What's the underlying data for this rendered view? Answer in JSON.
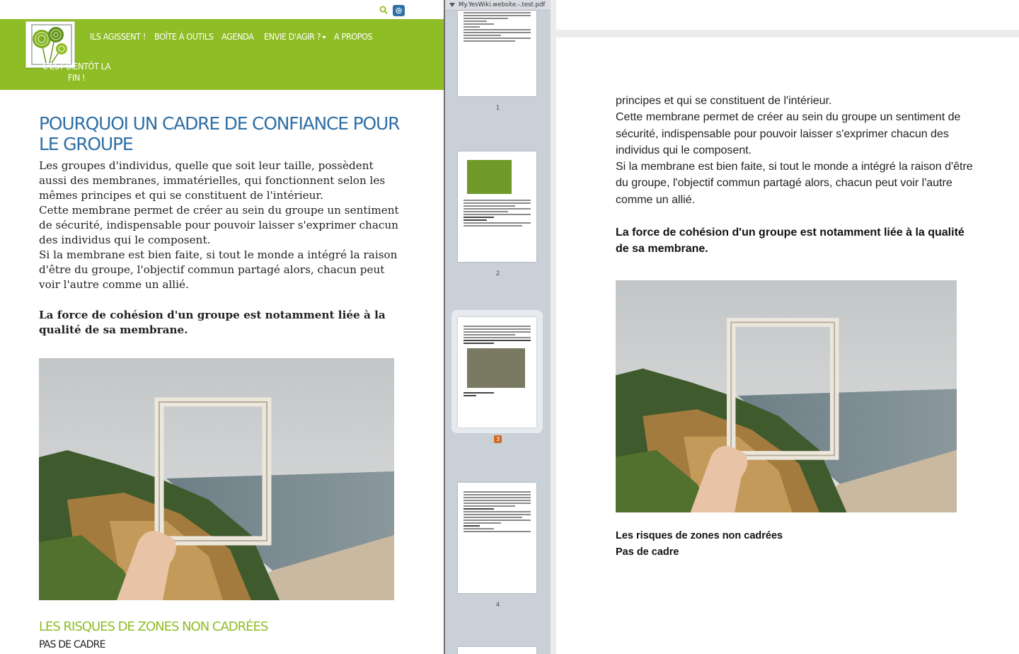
{
  "site": {
    "nav": {
      "items": [
        {
          "label": "ILS AGISSENT !"
        },
        {
          "label": "BOÎTE À OUTILS"
        },
        {
          "label": "AGENDA"
        },
        {
          "label": "ENVIE D'AGIR ?"
        },
        {
          "label": "A PROPOS"
        },
        {
          "label": "C'EST BIENTÔT LA FIN !"
        }
      ]
    },
    "title": "POURQUOI UN CADRE DE CONFIANCE POUR LE GROUPE",
    "paragraphs": [
      "Les groupes d'individus, quelle que soit leur taille, possèdent aussi des membranes, immatérielles, qui fonctionnent selon les mêmes principes et qui se constituent de l'intérieur.",
      "Cette membrane permet de créer au sein du groupe un sentiment de sécurité, indispensable pour pouvoir laisser s'exprimer chacun des individus qui le composent.",
      "Si la membrane est bien faite, si tout le monde a intégré la raison d'être du groupe, l'objectif commun partagé alors, chacun peut voir l'autre comme un allié."
    ],
    "bold": "La force de cohésion d'un groupe est notamment liée à la qualité de sa membrane.",
    "section_title": "LES RISQUES DE ZONES NON CADRÉES",
    "section_sub": "PAS DE CADRE",
    "accent_color": "#8fbd25",
    "title_color": "#2f6fa4"
  },
  "pdf": {
    "filename": "My.YesWiki.website.-.test.pdf",
    "thumbnails": [
      {
        "number": "1"
      },
      {
        "number": "2"
      },
      {
        "number": "3",
        "selected": true
      },
      {
        "number": "4"
      }
    ],
    "page": {
      "lines": [
        "principes et qui se constituent de l'intérieur.",
        "Cette membrane permet de créer au sein du groupe un sentiment de sécurité, indispensable pour pouvoir laisser s'exprimer chacun des individus qui le composent.",
        "Si la membrane est bien faite, si tout le monde a intégré la raison d'être du groupe, l'objectif commun partagé alors, chacun peut voir l'autre comme un allié."
      ],
      "bold": "La force de cohésion d'un groupe est notamment liée à la qualité de sa membrane.",
      "caption1": "Les risques de zones non cadrées",
      "caption2": "Pas de cadre"
    }
  }
}
